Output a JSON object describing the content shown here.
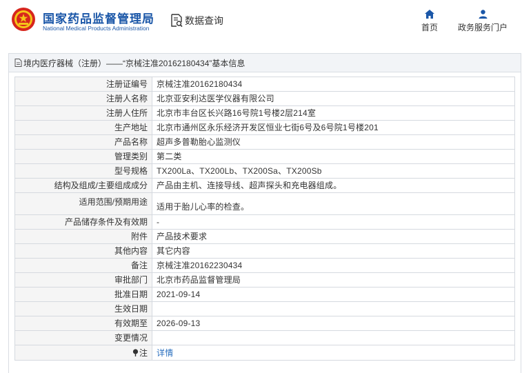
{
  "header": {
    "org_cn": "国家药品监督管理局",
    "org_en": "National Medical Products Administration",
    "query_label": "数据查询",
    "nav": {
      "home": "首页",
      "portal": "政务服务门户"
    }
  },
  "panel": {
    "title": "境内医疗器械（注册）——“京械注准20162180434”基本信息"
  },
  "rows": [
    {
      "label": "注册证编号",
      "value": "京械注准20162180434"
    },
    {
      "label": "注册人名称",
      "value": "北京亚安利达医学仪器有限公司"
    },
    {
      "label": "注册人住所",
      "value": "北京市丰台区长兴路16号院1号楼2层214室"
    },
    {
      "label": "生产地址",
      "value": "北京市通州区永乐经济开发区恒业七街6号及6号院1号楼201"
    },
    {
      "label": "产品名称",
      "value": "超声多普勒胎心监测仪"
    },
    {
      "label": "管理类别",
      "value": "第二类"
    },
    {
      "label": "型号规格",
      "value": "TX200La、TX200Lb、TX200Sa、TX200Sb"
    },
    {
      "label": "结构及组成/主要组成成分",
      "value": "产品由主机、连接导线、超声探头和充电器组成。"
    },
    {
      "label": "适用范围/预期用途",
      "value": "适用于胎儿心率的检查。"
    },
    {
      "label": "产品储存条件及有效期",
      "value": "-"
    },
    {
      "label": "附件",
      "value": "产品技术要求"
    },
    {
      "label": "其他内容",
      "value": "其它内容"
    },
    {
      "label": "备注",
      "value": "京械注准20162230434"
    },
    {
      "label": "审批部门",
      "value": "北京市药品监督管理局"
    },
    {
      "label": "批准日期",
      "value": "2021-09-14"
    },
    {
      "label": "生效日期",
      "value": ""
    },
    {
      "label": "有效期至",
      "value": "2026-09-13"
    },
    {
      "label": "变更情况",
      "value": ""
    },
    {
      "label": "注",
      "value": "详情"
    }
  ],
  "colors": {
    "brand": "#1b57a8",
    "link": "#2a6fbf",
    "emblem_red": "#d7261d",
    "emblem_gold": "#f5c518"
  },
  "icons": {
    "logo": "national-emblem-icon",
    "query": "document-search-icon",
    "home": "home-icon",
    "portal": "user-icon",
    "title": "document-icon",
    "note": "pin-icon"
  }
}
